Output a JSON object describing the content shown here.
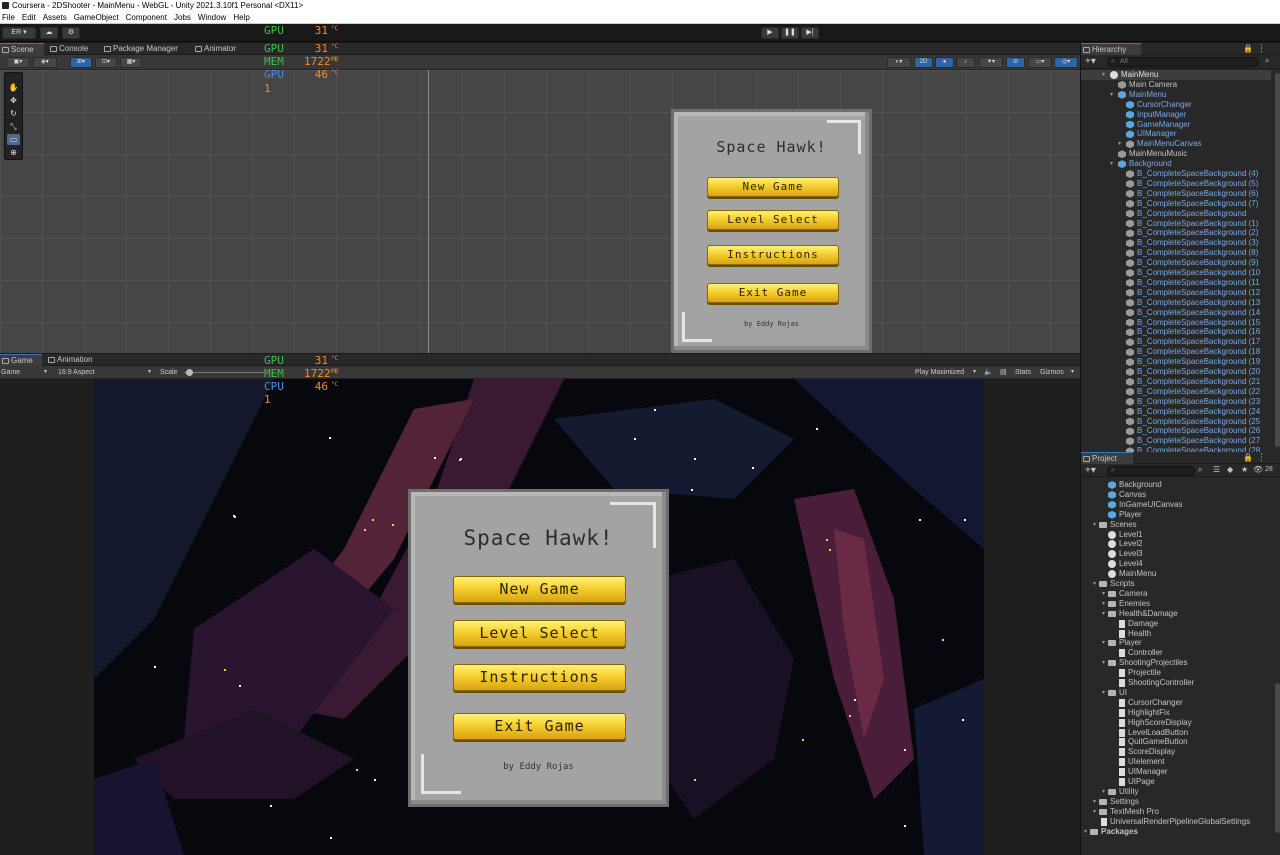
{
  "window": {
    "title": "Coursera - 2DShooter - MainMenu - WebGL - Unity 2021.3.10f1 Personal <DX11>"
  },
  "menu": [
    "File",
    "Edit",
    "Assets",
    "GameObject",
    "Component",
    "Jobs",
    "Window",
    "Help"
  ],
  "toolbar": {
    "account": "ER ▾",
    "play_icon": "▶",
    "pause_icon": "❚❚",
    "step_icon": "▶|"
  },
  "scene_tabs": [
    "Scene",
    "Console",
    "Package Manager",
    "Animator"
  ],
  "scene_toolbar": {
    "mode_2d": "2D"
  },
  "stats_scene": [
    {
      "label": "GPU",
      "value": "31",
      "unit": "°C",
      "color": "#3fbf4a"
    },
    {
      "label": "MEM",
      "value": "1722",
      "unit": "MB",
      "color": "#3fbf4a"
    },
    {
      "label": "GPU",
      "value": "46",
      "unit": "°C",
      "color": "#4a90e2"
    },
    {
      "label": "1",
      "value": "",
      "unit": "",
      "color": "#ff8a1e"
    }
  ],
  "stats_game": [
    {
      "label": "GPU",
      "value": "31",
      "unit": "°C",
      "color": "#3fbf4a"
    },
    {
      "label": "MEM",
      "value": "1722",
      "unit": "MB",
      "color": "#3fbf4a"
    },
    {
      "label": "CPU",
      "value": "46",
      "unit": "°C",
      "color": "#4a90e2"
    },
    {
      "label": "1",
      "value": "",
      "unit": "",
      "color": "#ff8a1e"
    }
  ],
  "game_tabs": [
    "Game",
    "Animation"
  ],
  "game_toolbar": {
    "display": "Game",
    "aspect": "16:9 Aspect",
    "scale": "Scale",
    "play_mode": "Play Maximized",
    "stats": "Stats",
    "gizmos": "Gizmos"
  },
  "main_menu": {
    "title": "Space Hawk!",
    "buttons": [
      "New Game",
      "Level Select",
      "Instructions",
      "Exit Game"
    ],
    "author": "by Eddy Rojas"
  },
  "hierarchy": {
    "tab": "Hierarchy",
    "search": "All",
    "items": [
      {
        "label": "MainMenu",
        "depth": 0,
        "icon": "unity",
        "color": "#e0e0e0",
        "arrow": true
      },
      {
        "label": "Main Camera",
        "depth": 1,
        "icon": "cube-g",
        "color": "#c4c4c4"
      },
      {
        "label": "MainMenu",
        "depth": 1,
        "icon": "cube",
        "color": "#7aa9e6",
        "arrow": true
      },
      {
        "label": "CursorChanger",
        "depth": 2,
        "icon": "cube",
        "color": "#7aa9e6"
      },
      {
        "label": "InputManager",
        "depth": 2,
        "icon": "cube",
        "color": "#7aa9e6"
      },
      {
        "label": "GameManager",
        "depth": 2,
        "icon": "cube",
        "color": "#7aa9e6"
      },
      {
        "label": "UIManager",
        "depth": 2,
        "icon": "cube",
        "color": "#7aa9e6"
      },
      {
        "label": "MainMenuCanvas",
        "depth": 2,
        "icon": "cube-g",
        "color": "#7aa9e6",
        "arrow": true
      },
      {
        "label": "MainMenuMusic",
        "depth": 1,
        "icon": "cube-g",
        "color": "#c4c4c4"
      },
      {
        "label": "Background",
        "depth": 1,
        "icon": "cube",
        "color": "#7aa9e6",
        "arrow": true
      },
      {
        "label": "B_CompleteSpaceBackground (4)",
        "depth": 2,
        "icon": "cube-g",
        "color": "#7aa9e6"
      },
      {
        "label": "B_CompleteSpaceBackground (5)",
        "depth": 2,
        "icon": "cube-g",
        "color": "#7aa9e6"
      },
      {
        "label": "B_CompleteSpaceBackground (6)",
        "depth": 2,
        "icon": "cube-g",
        "color": "#7aa9e6"
      },
      {
        "label": "B_CompleteSpaceBackground (7)",
        "depth": 2,
        "icon": "cube-g",
        "color": "#7aa9e6"
      },
      {
        "label": "B_CompleteSpaceBackground",
        "depth": 2,
        "icon": "cube-g",
        "color": "#7aa9e6"
      },
      {
        "label": "B_CompleteSpaceBackground (1)",
        "depth": 2,
        "icon": "cube-g",
        "color": "#7aa9e6"
      },
      {
        "label": "B_CompleteSpaceBackground (2)",
        "depth": 2,
        "icon": "cube-g",
        "color": "#7aa9e6"
      },
      {
        "label": "B_CompleteSpaceBackground (3)",
        "depth": 2,
        "icon": "cube-g",
        "color": "#7aa9e6"
      },
      {
        "label": "B_CompleteSpaceBackground (8)",
        "depth": 2,
        "icon": "cube-g",
        "color": "#7aa9e6"
      },
      {
        "label": "B_CompleteSpaceBackground (9)",
        "depth": 2,
        "icon": "cube-g",
        "color": "#7aa9e6"
      },
      {
        "label": "B_CompleteSpaceBackground (10",
        "depth": 2,
        "icon": "cube-g",
        "color": "#7aa9e6"
      },
      {
        "label": "B_CompleteSpaceBackground (11",
        "depth": 2,
        "icon": "cube-g",
        "color": "#7aa9e6"
      },
      {
        "label": "B_CompleteSpaceBackground (12",
        "depth": 2,
        "icon": "cube-g",
        "color": "#7aa9e6"
      },
      {
        "label": "B_CompleteSpaceBackground (13",
        "depth": 2,
        "icon": "cube-g",
        "color": "#7aa9e6"
      },
      {
        "label": "B_CompleteSpaceBackground (14",
        "depth": 2,
        "icon": "cube-g",
        "color": "#7aa9e6"
      },
      {
        "label": "B_CompleteSpaceBackground (15",
        "depth": 2,
        "icon": "cube-g",
        "color": "#7aa9e6"
      },
      {
        "label": "B_CompleteSpaceBackground (16",
        "depth": 2,
        "icon": "cube-g",
        "color": "#7aa9e6"
      },
      {
        "label": "B_CompleteSpaceBackground (17",
        "depth": 2,
        "icon": "cube-g",
        "color": "#7aa9e6"
      },
      {
        "label": "B_CompleteSpaceBackground (18",
        "depth": 2,
        "icon": "cube-g",
        "color": "#7aa9e6"
      },
      {
        "label": "B_CompleteSpaceBackground (19",
        "depth": 2,
        "icon": "cube-g",
        "color": "#7aa9e6"
      },
      {
        "label": "B_CompleteSpaceBackground (20",
        "depth": 2,
        "icon": "cube-g",
        "color": "#7aa9e6"
      },
      {
        "label": "B_CompleteSpaceBackground (21",
        "depth": 2,
        "icon": "cube-g",
        "color": "#7aa9e6"
      },
      {
        "label": "B_CompleteSpaceBackground (22",
        "depth": 2,
        "icon": "cube-g",
        "color": "#7aa9e6"
      },
      {
        "label": "B_CompleteSpaceBackground (23",
        "depth": 2,
        "icon": "cube-g",
        "color": "#7aa9e6"
      },
      {
        "label": "B_CompleteSpaceBackground (24",
        "depth": 2,
        "icon": "cube-g",
        "color": "#7aa9e6"
      },
      {
        "label": "B_CompleteSpaceBackground (25",
        "depth": 2,
        "icon": "cube-g",
        "color": "#7aa9e6"
      },
      {
        "label": "B_CompleteSpaceBackground (26",
        "depth": 2,
        "icon": "cube-g",
        "color": "#7aa9e6"
      },
      {
        "label": "B_CompleteSpaceBackground (27",
        "depth": 2,
        "icon": "cube-g",
        "color": "#7aa9e6"
      },
      {
        "label": "B_CompleteSpaceBackground (28",
        "depth": 2,
        "icon": "cube-g",
        "color": "#7aa9e6"
      }
    ]
  },
  "project": {
    "tab": "Project",
    "count": "28",
    "items": [
      {
        "label": "Background",
        "depth": 2,
        "icon": "cube"
      },
      {
        "label": "Canvas",
        "depth": 2,
        "icon": "cube"
      },
      {
        "label": "InGameUICanvas",
        "depth": 2,
        "icon": "cube"
      },
      {
        "label": "Player",
        "depth": 2,
        "icon": "cube"
      },
      {
        "label": "Scenes",
        "depth": 1,
        "icon": "folder",
        "arrow": true
      },
      {
        "label": "Level1",
        "depth": 2,
        "icon": "unity"
      },
      {
        "label": "Level2",
        "depth": 2,
        "icon": "unity"
      },
      {
        "label": "Level3",
        "depth": 2,
        "icon": "unity"
      },
      {
        "label": "Level4",
        "depth": 2,
        "icon": "unity"
      },
      {
        "label": "MainMenu",
        "depth": 2,
        "icon": "unity"
      },
      {
        "label": "Scripts",
        "depth": 1,
        "icon": "folder",
        "arrow": true
      },
      {
        "label": "Camera",
        "depth": 2,
        "icon": "folder",
        "arrow": true
      },
      {
        "label": "Enemies",
        "depth": 2,
        "icon": "folder",
        "arrow": true
      },
      {
        "label": "Health&Damage",
        "depth": 2,
        "icon": "folder",
        "arrow": true
      },
      {
        "label": "Damage",
        "depth": 3,
        "icon": "script"
      },
      {
        "label": "Health",
        "depth": 3,
        "icon": "script"
      },
      {
        "label": "Player",
        "depth": 2,
        "icon": "folder",
        "arrow": true
      },
      {
        "label": "Controller",
        "depth": 3,
        "icon": "script"
      },
      {
        "label": "ShootingProjectiles",
        "depth": 2,
        "icon": "folder",
        "arrow": true
      },
      {
        "label": "Projectile",
        "depth": 3,
        "icon": "script"
      },
      {
        "label": "ShootingController",
        "depth": 3,
        "icon": "script"
      },
      {
        "label": "UI",
        "depth": 2,
        "icon": "folder",
        "arrow": true
      },
      {
        "label": "CursorChanger",
        "depth": 3,
        "icon": "script"
      },
      {
        "label": "HighlightFix",
        "depth": 3,
        "icon": "script"
      },
      {
        "label": "HighScoreDisplay",
        "depth": 3,
        "icon": "script"
      },
      {
        "label": "LevelLoadButton",
        "depth": 3,
        "icon": "script"
      },
      {
        "label": "QuitGameButton",
        "depth": 3,
        "icon": "script"
      },
      {
        "label": "ScoreDisplay",
        "depth": 3,
        "icon": "script"
      },
      {
        "label": "UIelement",
        "depth": 3,
        "icon": "script"
      },
      {
        "label": "UIManager",
        "depth": 3,
        "icon": "script"
      },
      {
        "label": "UIPage",
        "depth": 3,
        "icon": "script"
      },
      {
        "label": "Utility",
        "depth": 2,
        "icon": "folder",
        "arrow": true
      },
      {
        "label": "Settings",
        "depth": 1,
        "icon": "folder",
        "arrow": true
      },
      {
        "label": "TextMesh Pro",
        "depth": 1,
        "icon": "folder",
        "arrow": true
      },
      {
        "label": "UniversalRenderPipelineGlobalSettings",
        "depth": 1,
        "icon": "script"
      },
      {
        "label": "Packages",
        "depth": 0,
        "icon": "folder",
        "arrow": true
      }
    ]
  }
}
